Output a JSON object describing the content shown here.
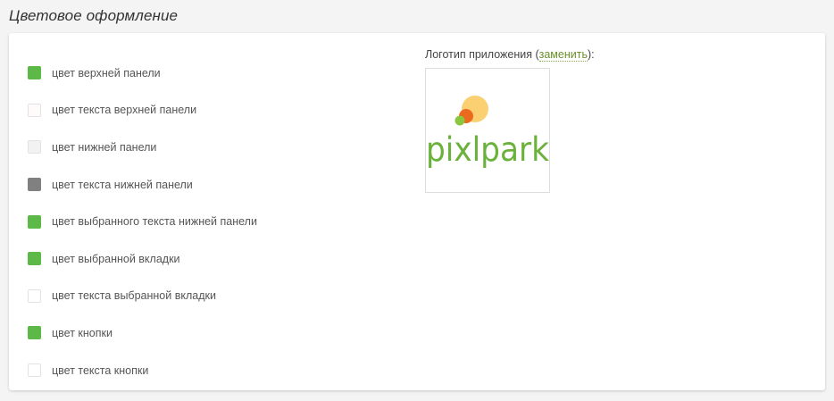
{
  "section": {
    "title": "Цветовое оформление"
  },
  "colors": [
    {
      "label": "цвет верхней панели",
      "color": "#5cb947"
    },
    {
      "label": "цвет текста верхней панели",
      "color": "#fffbfb"
    },
    {
      "label": "цвет нижней панели",
      "color": "#f2f2f2"
    },
    {
      "label": "цвет текста нижней панели",
      "color": "#808080"
    },
    {
      "label": "цвет выбранного текста нижней панели",
      "color": "#5cb947"
    },
    {
      "label": "цвет выбранной вкладки",
      "color": "#5cb947"
    },
    {
      "label": "цвет текста выбранной вкладки",
      "color": "#ffffff"
    },
    {
      "label": "цвет кнопки",
      "color": "#5cb947"
    },
    {
      "label": "цвет текста кнопки",
      "color": "#ffffff"
    }
  ],
  "logo": {
    "caption_prefix": "Логотип приложения (",
    "replace_label": "заменить",
    "caption_suffix": "):",
    "logo_text": "pixlpark",
    "logo_colors": {
      "text": "#6ab23c",
      "circle_yellow": "#f9c85a",
      "circle_orange": "#ec6a1e",
      "circle_green": "#8cc63f"
    }
  }
}
